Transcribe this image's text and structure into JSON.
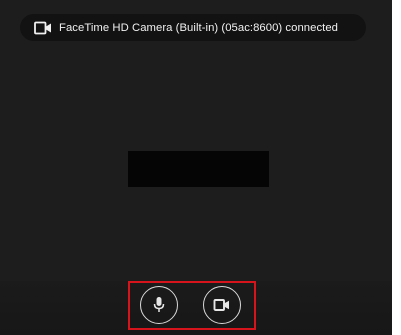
{
  "toast": {
    "icon": "video-camera-icon",
    "text": "FaceTime HD Camera (Built-in) (05ac:8600)  connected"
  },
  "controls": {
    "mic_icon": "microphone-icon",
    "camera_icon": "video-camera-icon"
  },
  "colors": {
    "background": "#1d1d1d",
    "toast_background": "#121212",
    "video_tile": "#050505",
    "highlight_border": "#d6141b",
    "icon_stroke": "#d9d9d9"
  }
}
